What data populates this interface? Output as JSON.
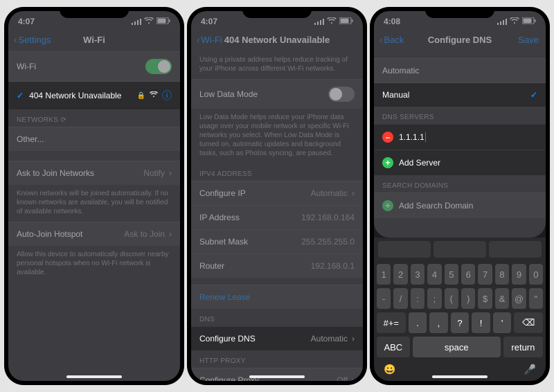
{
  "screen1": {
    "time": "4:07",
    "back": "Settings",
    "title": "Wi-Fi",
    "wifi_toggle_label": "Wi-Fi",
    "connected_network": "404 Network Unavailable",
    "networks_header": "NETWORKS",
    "other": "Other...",
    "ask_join_label": "Ask to Join Networks",
    "ask_join_value": "Notify",
    "ask_join_footer": "Known networks will be joined automatically. If no known networks are available, you will be notified of available networks.",
    "autojoin_label": "Auto-Join Hotspot",
    "autojoin_value": "Ask to Join",
    "autojoin_footer": "Allow this device to automatically discover nearby personal hotspots when no Wi-Fi network is available."
  },
  "screen2": {
    "time": "4:07",
    "back": "Wi-Fi",
    "title": "404 Network Unavailable",
    "private_footer": "Using a private address helps reduce tracking of your iPhone across different Wi-Fi networks.",
    "low_data_label": "Low Data Mode",
    "low_data_footer": "Low Data Mode helps reduce your iPhone data usage over your mobile network or specific Wi-Fi networks you select. When Low Data Mode is turned on, automatic updates and background tasks, such as Photos syncing, are paused.",
    "ipv4_header": "IPV4 ADDRESS",
    "configure_ip_label": "Configure IP",
    "configure_ip_value": "Automatic",
    "ip_label": "IP Address",
    "ip_value": "192.168.0.164",
    "subnet_label": "Subnet Mask",
    "subnet_value": "255.255.255.0",
    "router_label": "Router",
    "router_value": "192.168.0.1",
    "renew": "Renew Lease",
    "dns_header": "DNS",
    "configure_dns_label": "Configure DNS",
    "configure_dns_value": "Automatic",
    "proxy_header": "HTTP PROXY",
    "proxy_label": "Configure Proxy",
    "proxy_value": "Off"
  },
  "screen3": {
    "time": "4:08",
    "back": "Back",
    "title": "Configure DNS",
    "save": "Save",
    "automatic": "Automatic",
    "manual": "Manual",
    "dns_servers_header": "DNS SERVERS",
    "dns_entry": "1.1.1.1",
    "add_server": "Add Server",
    "search_domains_header": "SEARCH DOMAINS",
    "add_domain": "Add Search Domain",
    "keyboard": {
      "row1": [
        "1",
        "2",
        "3",
        "4",
        "5",
        "6",
        "7",
        "8",
        "9",
        "0"
      ],
      "row2": [
        "-",
        "/",
        ":",
        ";",
        "(",
        ")",
        "$",
        "&",
        "@",
        "\""
      ],
      "row3_shift": "#+=",
      "row3": [
        ".",
        ",",
        "?",
        "!",
        "'"
      ],
      "row3_del": "⌫",
      "abc": "ABC",
      "space": "space",
      "return": "return"
    }
  }
}
